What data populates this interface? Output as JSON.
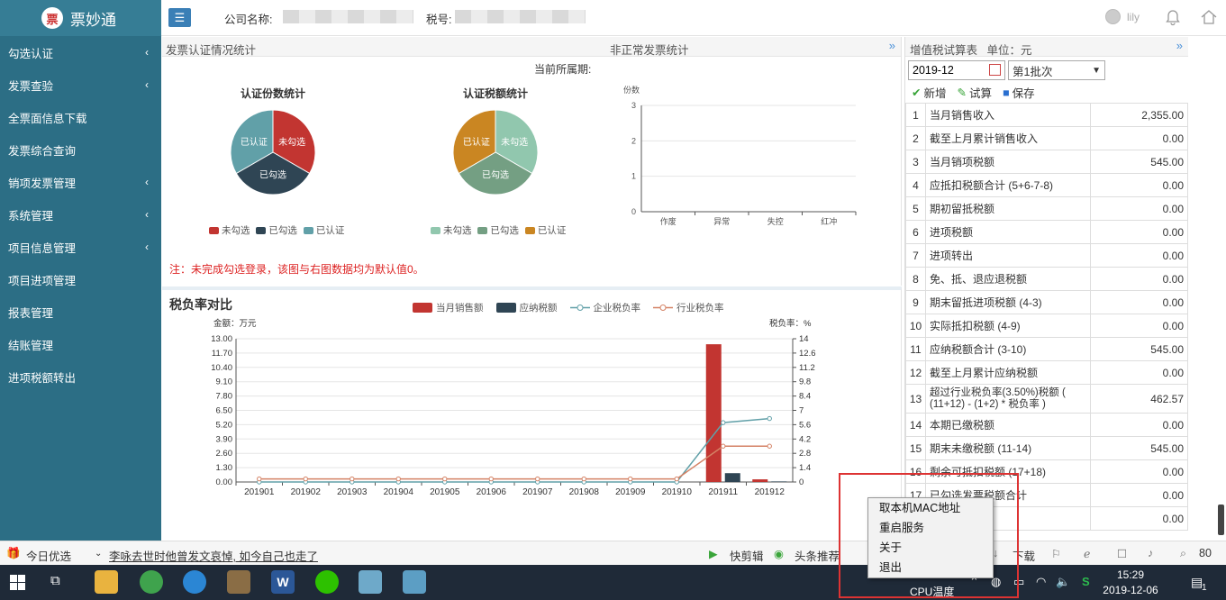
{
  "app": {
    "name": "票妙通",
    "logo_char": "票"
  },
  "sidebar": {
    "items": [
      {
        "label": "勾选认证",
        "chevron": "‹"
      },
      {
        "label": "发票查验",
        "chevron": "‹"
      },
      {
        "label": "全票面信息下载",
        "chevron": ""
      },
      {
        "label": "发票综合查询",
        "chevron": ""
      },
      {
        "label": "销项发票管理",
        "chevron": "‹"
      },
      {
        "label": "系统管理",
        "chevron": "‹"
      },
      {
        "label": "项目信息管理",
        "chevron": "‹"
      },
      {
        "label": "项目进项管理",
        "chevron": ""
      },
      {
        "label": "报表管理",
        "chevron": ""
      },
      {
        "label": "结账管理",
        "chevron": ""
      },
      {
        "label": "进项税额转出",
        "chevron": ""
      }
    ]
  },
  "header": {
    "company_label": "公司名称:",
    "tax_label": "税号:",
    "username": "lily"
  },
  "stats": {
    "title_left": "发票认证情况统计",
    "title_right": "非正常发票统计",
    "period_label": "当前所属期:",
    "note": "注：未完成勾选登录，该图与右图数据均为默认值0。",
    "pie1": {
      "title": "认证份数统计",
      "slices": [
        {
          "label": "未勾选",
          "value": 1,
          "color": "#c23531"
        },
        {
          "label": "已勾选",
          "value": 1,
          "color": "#2f4554"
        },
        {
          "label": "已认证",
          "value": 1,
          "color": "#61a0a8"
        }
      ]
    },
    "pie2": {
      "title": "认证税额统计",
      "slices": [
        {
          "label": "未勾选",
          "value": 1,
          "color": "#91c7ae"
        },
        {
          "label": "已勾选",
          "value": 1,
          "color": "#749f83"
        },
        {
          "label": "已认证",
          "value": 1,
          "color": "#ca8622"
        }
      ]
    },
    "abnormal": {
      "ylabel": "份数",
      "categories": [
        "作废",
        "异常",
        "失控",
        "红冲"
      ],
      "ylim": [
        0,
        3
      ],
      "ticks": [
        "0",
        "1",
        "2",
        "3"
      ]
    }
  },
  "tax": {
    "title": "税负率对比",
    "left_unit": "金额：万元",
    "right_unit": "税负率：%",
    "legend": [
      "当月销售额",
      "应纳税额",
      "企业税负率",
      "行业税负率"
    ]
  },
  "chart_data": {
    "type": "bar",
    "categories": [
      "201901",
      "201902",
      "201903",
      "201904",
      "201905",
      "201906",
      "201907",
      "201908",
      "201909",
      "201910",
      "201911",
      "201912"
    ],
    "series": [
      {
        "name": "当月销售额",
        "kind": "bar",
        "axis": "left",
        "color": "#c23531",
        "values": [
          0,
          0,
          0,
          0,
          0,
          0,
          0,
          0,
          0,
          0,
          12.5,
          0.24
        ]
      },
      {
        "name": "应纳税额",
        "kind": "bar",
        "axis": "left",
        "color": "#2f4554",
        "values": [
          0,
          0,
          0,
          0,
          0,
          0,
          0,
          0,
          0,
          0,
          0.8,
          0.05
        ]
      },
      {
        "name": "企业税负率",
        "kind": "line",
        "axis": "right",
        "color": "#61a0a8",
        "values": [
          0,
          0,
          0,
          0,
          0,
          0,
          0,
          0,
          0,
          0,
          5.8,
          6.2
        ]
      },
      {
        "name": "行业税负率",
        "kind": "line",
        "axis": "right",
        "color": "#d48265",
        "values": [
          0.3,
          0.3,
          0.3,
          0.3,
          0.3,
          0.3,
          0.3,
          0.3,
          0.3,
          0.3,
          3.5,
          3.5
        ]
      }
    ],
    "ylim": [
      0,
      13
    ],
    "y2lim": [
      0,
      14
    ],
    "yticks": [
      "0.00",
      "1.30",
      "2.60",
      "3.90",
      "5.20",
      "6.50",
      "7.80",
      "9.10",
      "10.40",
      "11.70",
      "13.00"
    ],
    "y2ticks": [
      "0",
      "1.4",
      "2.8",
      "4.2",
      "5.6",
      "7",
      "8.4",
      "9.8",
      "11.2",
      "12.6",
      "14"
    ],
    "ylabel": "金额：万元",
    "y2label": "税负率：%"
  },
  "vat": {
    "title": "增值税试算表",
    "unit": "单位：元",
    "month": "2019-12",
    "batch": "第1批次",
    "toolbar": {
      "add": "新增",
      "calc": "试算",
      "save": "保存"
    },
    "rows": [
      {
        "n": "1",
        "name": "当月销售收入",
        "val": "2,355.00"
      },
      {
        "n": "2",
        "name": "截至上月累计销售收入",
        "val": "0.00"
      },
      {
        "n": "3",
        "name": "当月销项税额",
        "val": "545.00"
      },
      {
        "n": "4",
        "name": "应抵扣税额合计 (5+6-7-8)",
        "val": "0.00"
      },
      {
        "n": "5",
        "name": "期初留抵税额",
        "val": "0.00"
      },
      {
        "n": "6",
        "name": "进项税额",
        "val": "0.00"
      },
      {
        "n": "7",
        "name": "进项转出",
        "val": "0.00"
      },
      {
        "n": "8",
        "name": "免、抵、退应退税额",
        "val": "0.00"
      },
      {
        "n": "9",
        "name": "期末留抵进项税额 (4-3)",
        "val": "0.00"
      },
      {
        "n": "10",
        "name": "实际抵扣税额 (4-9)",
        "val": "0.00"
      },
      {
        "n": "11",
        "name": "应纳税额合计 (3-10)",
        "val": "545.00"
      },
      {
        "n": "12",
        "name": "截至上月累计应纳税额",
        "val": "0.00"
      },
      {
        "n": "13",
        "name": "超过行业税负率(3.50%)税额 ( (11+12) - (1+2) * 税负率 )",
        "val": "462.57"
      },
      {
        "n": "14",
        "name": "本期已缴税额",
        "val": "0.00"
      },
      {
        "n": "15",
        "name": "期末未缴税额 (11-14)",
        "val": "545.00"
      },
      {
        "n": "16",
        "name": "剩余可抵扣税额 (17+18)",
        "val": "0.00"
      },
      {
        "n": "17",
        "name": "已勾选发票税额合计",
        "val": "0.00"
      },
      {
        "n": "18",
        "name": "额合计",
        "val": "0.00"
      }
    ]
  },
  "newsbar": {
    "today": "今日优选",
    "headline": "李咏去世时他曾发文哀悼, 如今自己也走了",
    "kuaijianji": "快剪辑",
    "toutiao": "头条推荐",
    "download": "下载",
    "zoom": "80"
  },
  "context_menu": {
    "items": [
      "取本机MAC地址",
      "重启服务",
      "关于",
      "退出"
    ]
  },
  "taskbar": {
    "time": "15:29",
    "date": "2019-12-06",
    "cpu_label": "CPU温度",
    "notify_count": "1"
  }
}
